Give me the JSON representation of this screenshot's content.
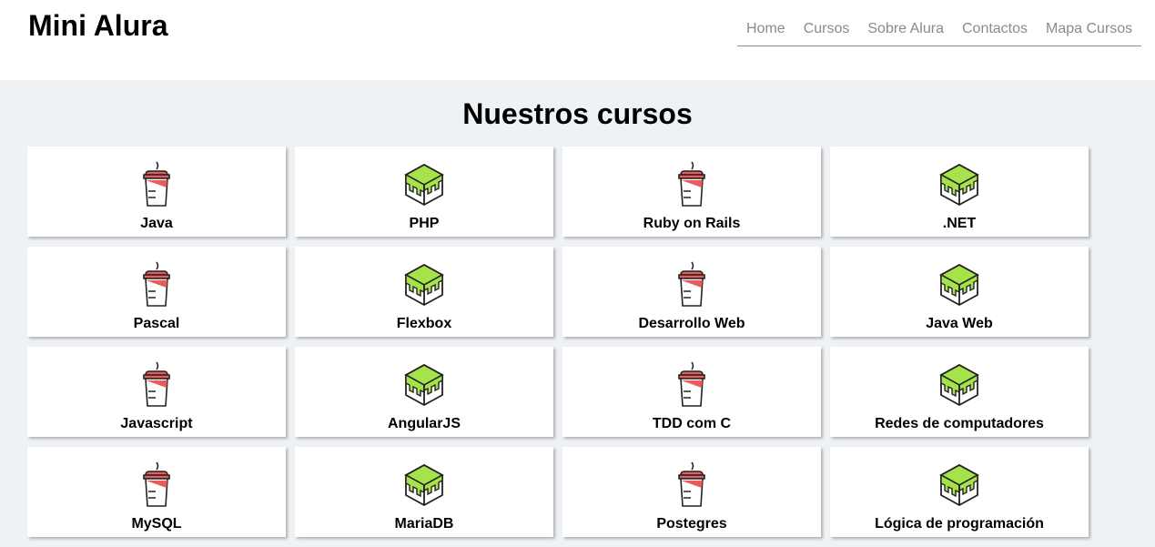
{
  "header": {
    "brand": "Mini Alura",
    "nav": [
      "Home",
      "Cursos",
      "Sobre Alura",
      "Contactos",
      "Mapa Cursos"
    ]
  },
  "main": {
    "title": "Nuestros cursos",
    "courses": [
      {
        "name": "Java",
        "icon": "coffee-cup-icon"
      },
      {
        "name": "PHP",
        "icon": "green-cube-icon"
      },
      {
        "name": "Ruby on Rails",
        "icon": "coffee-cup-icon"
      },
      {
        "name": ".NET",
        "icon": "green-cube-icon"
      },
      {
        "name": "Pascal",
        "icon": "coffee-cup-icon"
      },
      {
        "name": "Flexbox",
        "icon": "green-cube-icon"
      },
      {
        "name": "Desarrollo Web",
        "icon": "coffee-cup-icon"
      },
      {
        "name": "Java Web",
        "icon": "green-cube-icon"
      },
      {
        "name": "Javascript",
        "icon": "coffee-cup-icon"
      },
      {
        "name": "AngularJS",
        "icon": "green-cube-icon"
      },
      {
        "name": "TDD com C",
        "icon": "coffee-cup-icon"
      },
      {
        "name": "Redes de computadores",
        "icon": "green-cube-icon"
      },
      {
        "name": "MySQL",
        "icon": "coffee-cup-icon"
      },
      {
        "name": "MariaDB",
        "icon": "green-cube-icon"
      },
      {
        "name": "Postegres",
        "icon": "coffee-cup-icon"
      },
      {
        "name": "Lógica de programación",
        "icon": "green-cube-icon"
      }
    ]
  },
  "colors": {
    "page_bg": "#eff2f5",
    "cup_red": "#e85c5c",
    "cube_green": "#a6e34a",
    "nav_text": "#8a8a8a"
  }
}
